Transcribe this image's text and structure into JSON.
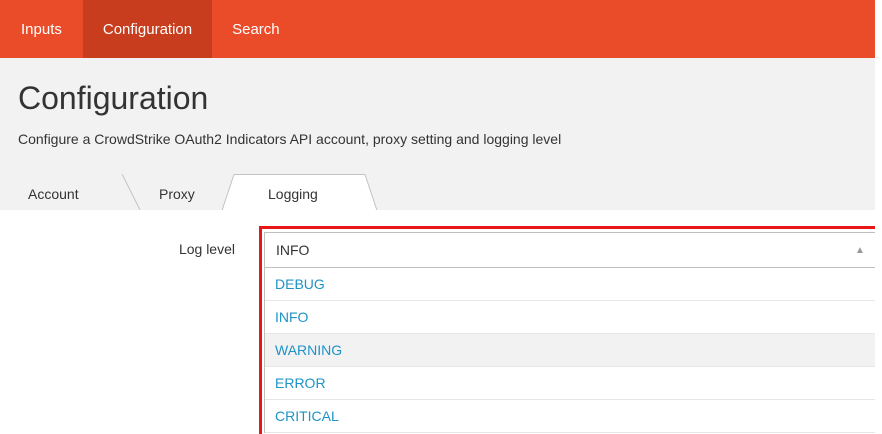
{
  "nav": {
    "items": [
      {
        "label": "Inputs",
        "active": false
      },
      {
        "label": "Configuration",
        "active": true
      },
      {
        "label": "Search",
        "active": false
      }
    ]
  },
  "header": {
    "title": "Configuration",
    "description": "Configure a CrowdStrike OAuth2 Indicators API account, proxy setting and logging level"
  },
  "tabs": [
    {
      "label": "Account",
      "active": false
    },
    {
      "label": "Proxy",
      "active": false
    },
    {
      "label": "Logging",
      "active": true
    }
  ],
  "form": {
    "log_level_label": "Log level",
    "selected_value": "INFO",
    "options": [
      "DEBUG",
      "INFO",
      "WARNING",
      "ERROR",
      "CRITICAL"
    ],
    "highlighted_option": "WARNING"
  },
  "colors": {
    "nav_bg": "#ea4b29",
    "nav_active_bg": "#c93d1f",
    "header_bg": "#f2f2f2",
    "option_text": "#1e93c6",
    "focus_outline": "#e81717"
  }
}
